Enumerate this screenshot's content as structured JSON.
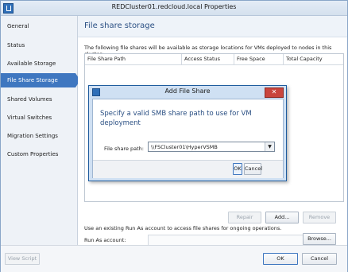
{
  "window": {
    "title": "REDCluster01.redcloud.local Properties"
  },
  "sidebar": {
    "items": [
      {
        "label": "General"
      },
      {
        "label": "Status"
      },
      {
        "label": "Available Storage"
      },
      {
        "label": "File Share Storage"
      },
      {
        "label": "Shared Volumes"
      },
      {
        "label": "Virtual Switches"
      },
      {
        "label": "Migration Settings"
      },
      {
        "label": "Custom Properties"
      }
    ],
    "active_index": 3
  },
  "main": {
    "title": "File share storage",
    "description": "The following file shares will be available as storage locations for VMs deployed to nodes in this cluster:",
    "table": {
      "columns": [
        "File Share Path",
        "Access Status",
        "Free Space",
        "Total Capacity"
      ]
    },
    "buttons": {
      "repair": "Repair",
      "add": "Add...",
      "remove": "Remove"
    },
    "runas": {
      "description": "Use an existing Run As account to access file shares for ongoing operations.",
      "label": "Run As account:",
      "value": "",
      "browse": "Browse..."
    }
  },
  "footer": {
    "view_script": "View Script",
    "ok": "OK",
    "cancel": "Cancel"
  },
  "dialog": {
    "title": "Add File Share",
    "close_glyph": "✕",
    "message": "Specify a valid SMB share path to use for VM deployment",
    "field_label": "File share path:",
    "field_value": "\\\\FSCluster01\\HyperVSMB",
    "ok": "OK",
    "cancel": "Cancel"
  },
  "colors": {
    "accent": "#3f77c0",
    "title_blue": "#2a4f83",
    "close_red": "#c9453d"
  }
}
